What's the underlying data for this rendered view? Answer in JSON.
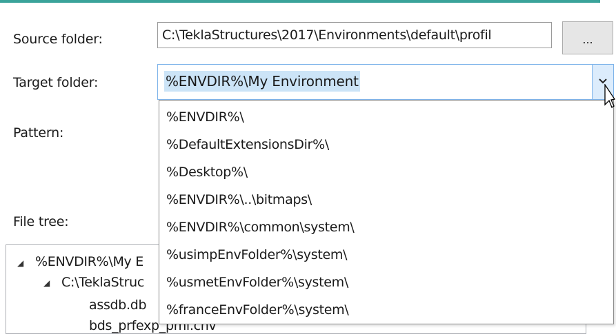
{
  "labels": {
    "source_folder": "Source folder:",
    "target_folder": "Target folder:",
    "pattern": "Pattern:",
    "file_tree": "File tree:"
  },
  "source_folder": {
    "value": "C:\\TeklaStructures\\2017\\Environments\\default\\profil",
    "browse_label": "..."
  },
  "target_folder": {
    "selected": "%ENVDIR%\\My Environment",
    "options": [
      "%ENVDIR%\\",
      "%DefaultExtensionsDir%\\",
      "%Desktop%\\",
      "%ENVDIR%\\..\\bitmaps\\",
      "%ENVDIR%\\common\\system\\",
      "%usimpEnvFolder%\\system\\",
      "%usmetEnvFolder%\\system\\",
      "%franceEnvFolder%\\system\\"
    ]
  },
  "tree": {
    "rows": [
      "%ENVDIR%\\My E",
      "C:\\TeklaStruc",
      "assdb.db",
      "bds_prfexp_pml.cnv"
    ]
  },
  "icons": {
    "combo_arrow": "chevron-down-icon",
    "tree_expand": "triangle-expanded-icon",
    "cursor": "mouse-pointer-icon"
  },
  "colors": {
    "accent": "#3aa39a",
    "selection": "#cce4f7",
    "focus_border": "#7eb4ea"
  }
}
